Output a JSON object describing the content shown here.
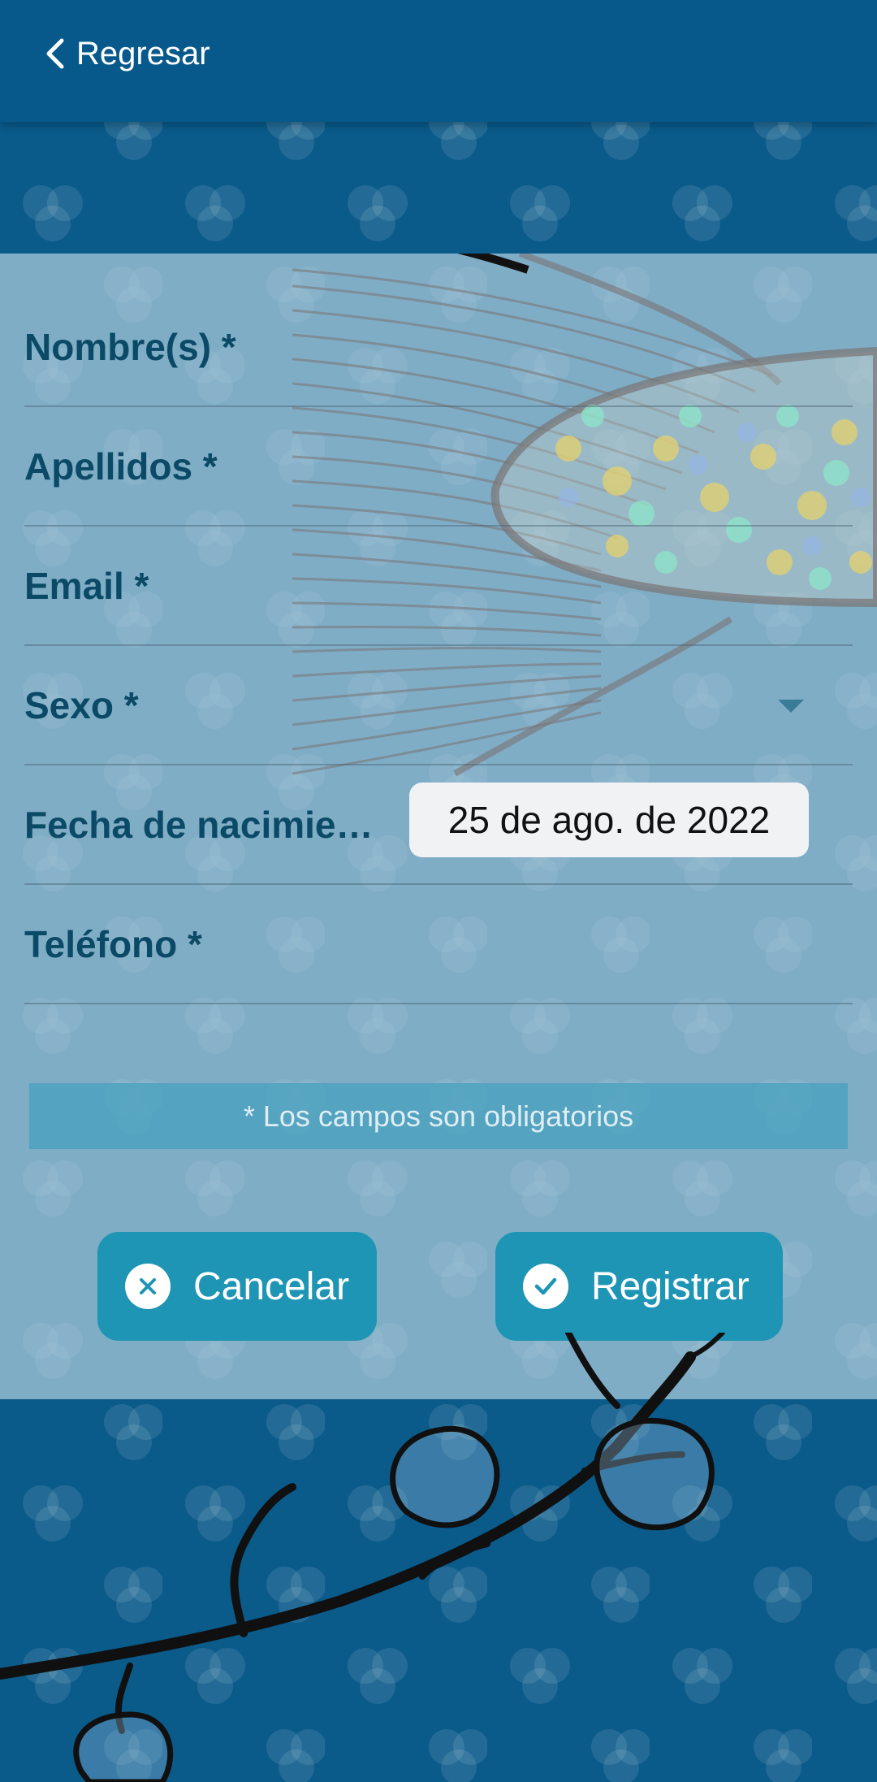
{
  "header": {
    "back_label": "Regresar"
  },
  "form": {
    "fields": [
      {
        "label": "Nombre(s) *"
      },
      {
        "label": "Apellidos *"
      },
      {
        "label": "Email *"
      },
      {
        "label": "Sexo *"
      },
      {
        "label": "Fecha de nacimie…",
        "value": "25 de ago. de 2022"
      },
      {
        "label": "Teléfono *"
      }
    ],
    "required_notice": "* Los campos son obligatorios"
  },
  "actions": {
    "cancel_label": "Cancelar",
    "register_label": "Registrar"
  },
  "colors": {
    "header": "#06598a",
    "button": "#1e95b4",
    "label": "#0b4a66"
  }
}
